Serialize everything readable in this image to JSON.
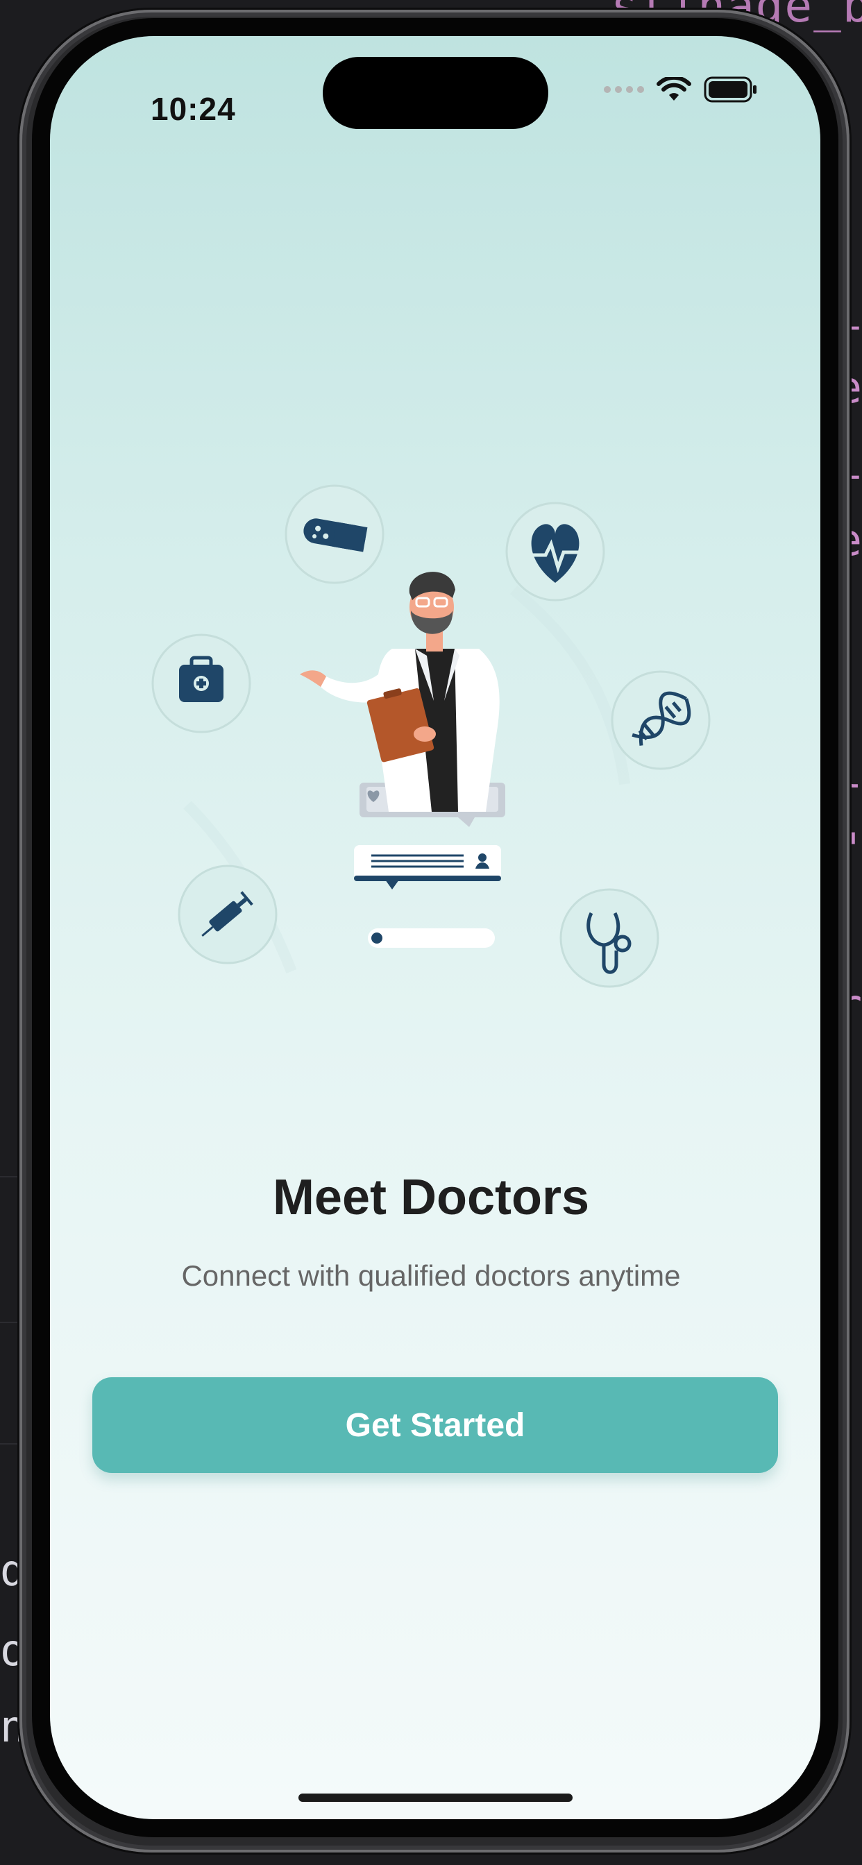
{
  "background_code": {
    "top": "stinage_bu",
    "right_fragments": [
      "i",
      "e",
      "i",
      "e",
      "l",
      "\"",
      "r"
    ],
    "left_fragments": [
      "d",
      "or",
      "n"
    ]
  },
  "status_bar": {
    "time": "10:24",
    "wifi_icon": "wifi-icon",
    "battery_icon": "battery-icon"
  },
  "illustration": {
    "icons": [
      "bandage-icon",
      "heart-pulse-icon",
      "medical-bag-icon",
      "dna-icon",
      "syringe-icon",
      "stethoscope-icon"
    ],
    "figure": "doctor-with-clipboard"
  },
  "onboarding": {
    "title": "Meet Doctors",
    "subtitle": "Connect with qualified doctors anytime",
    "button_label": "Get Started"
  },
  "colors": {
    "accent": "#58b9b4",
    "icon_navy": "#1f4668",
    "title_text": "#1f1f1f"
  }
}
